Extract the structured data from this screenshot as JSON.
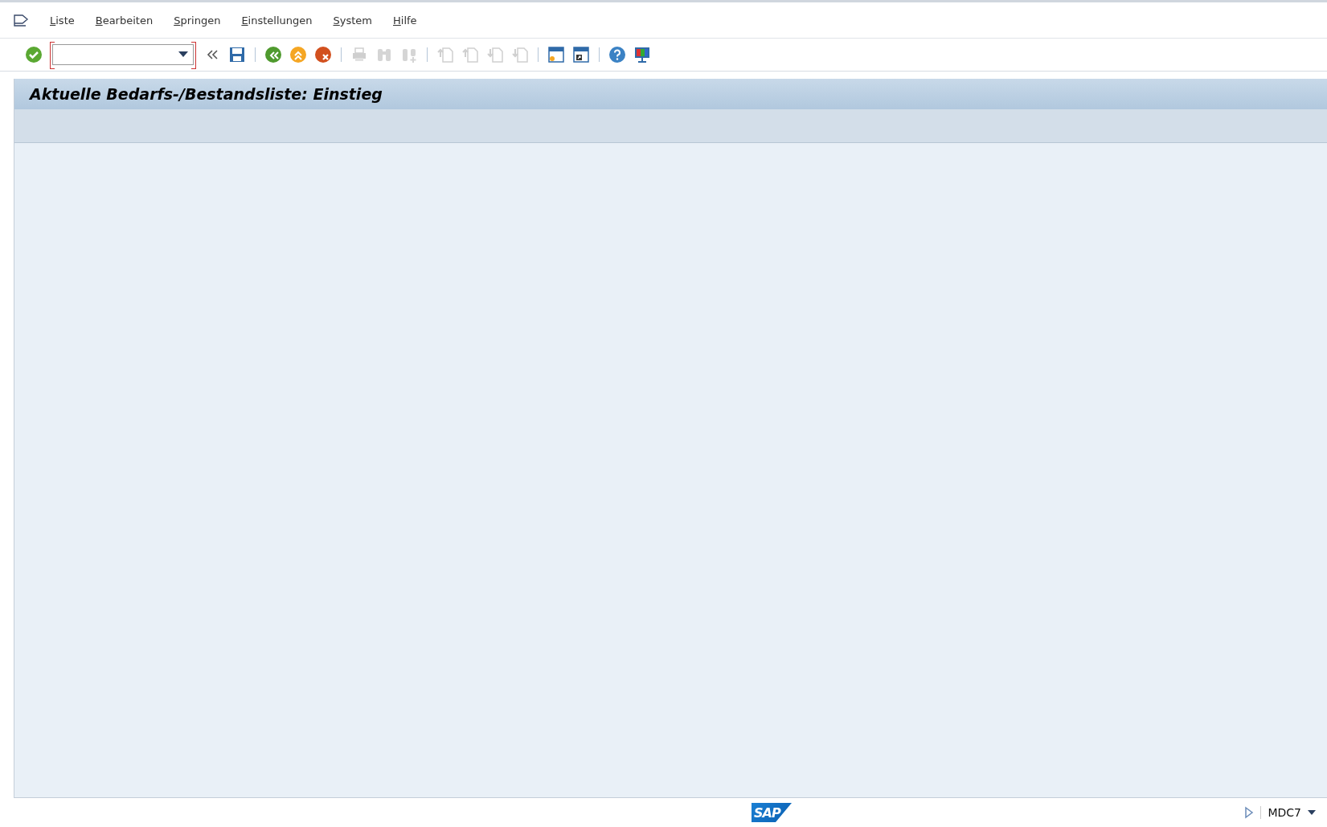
{
  "menu": [
    "Liste",
    "Bearbeiten",
    "Springen",
    "Einstellungen",
    "System",
    "Hilfe"
  ],
  "toolbar": [
    {
      "kind": "enter",
      "disabled": false
    },
    {
      "kind": "command"
    },
    {
      "kind": "collapse",
      "disabled": false
    },
    {
      "kind": "save",
      "disabled": false
    },
    {
      "kind": "sep"
    },
    {
      "kind": "back",
      "disabled": false
    },
    {
      "kind": "exit",
      "disabled": false
    },
    {
      "kind": "cancel",
      "disabled": false
    },
    {
      "kind": "sep"
    },
    {
      "kind": "print",
      "disabled": true
    },
    {
      "kind": "find",
      "disabled": true
    },
    {
      "kind": "findnext",
      "disabled": true
    },
    {
      "kind": "sep"
    },
    {
      "kind": "first",
      "disabled": true
    },
    {
      "kind": "prev",
      "disabled": true
    },
    {
      "kind": "next",
      "disabled": true
    },
    {
      "kind": "last",
      "disabled": true
    },
    {
      "kind": "sep"
    },
    {
      "kind": "newsession",
      "disabled": false
    },
    {
      "kind": "shortcut",
      "disabled": false
    },
    {
      "kind": "sep"
    },
    {
      "kind": "help",
      "disabled": false
    },
    {
      "kind": "layout",
      "disabled": false
    }
  ],
  "screen": {
    "title": "Aktuelle Bedarfs-/Bestandsliste: Einstieg"
  },
  "status_bar": {
    "logo": "SAP",
    "system": "MDC7"
  }
}
